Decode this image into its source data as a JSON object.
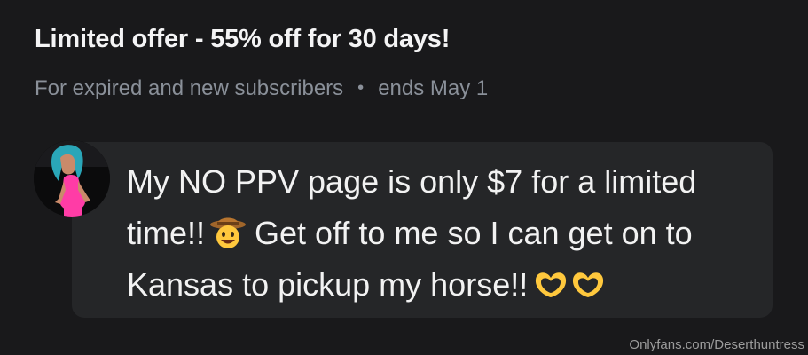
{
  "offer": {
    "title": "Limited offer - 55% off for 30 days!",
    "subtitle": "For expired and new subscribers",
    "separator": "•",
    "ends": "ends May 1"
  },
  "post": {
    "line1": "My NO PPV page is only $7 for a limited",
    "line2_a": "time!!",
    "line2_b": "Get off to me so I can get on to",
    "line3": "Kansas to pickup my horse!!",
    "emojis": [
      "cowboy-hat-face-emoji",
      "heart-hands-emoji",
      "heart-hands-emoji"
    ]
  },
  "watermark": "Onlyfans.com/Deserthuntress",
  "colors": {
    "background": "#19191b",
    "bubble": "#252628",
    "subtext": "#8a9099"
  }
}
